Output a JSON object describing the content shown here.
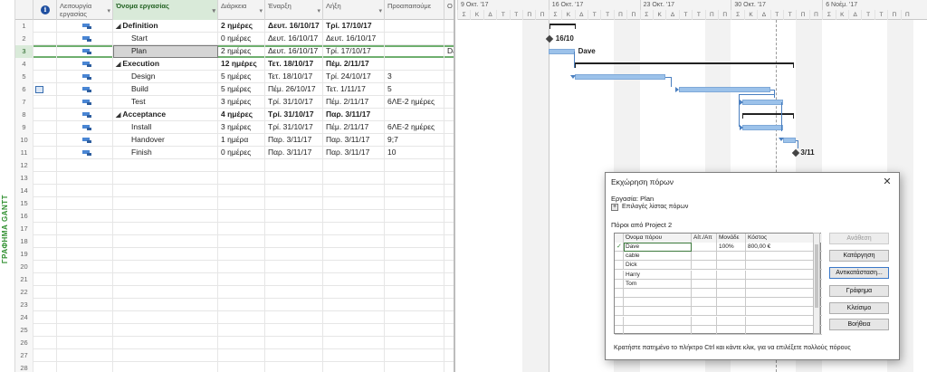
{
  "side_label": "ΓΡΑΦΗΜΑ GANTT",
  "table": {
    "headers": {
      "info": "i",
      "mode": "Λειτουργία εργασίας",
      "name": "Όνομα εργασίας",
      "duration": "Διάρκεια",
      "start": "Έναρξη",
      "finish": "Λήξη",
      "predecessors": "Προαπαιτούμε",
      "resources": "Ο"
    },
    "rows": [
      {
        "num": "1",
        "name": "Definition",
        "duration": "2 ημέρες",
        "start": "Δευτ. 16/10/17",
        "finish": "Τρί. 17/10/17",
        "pred": "",
        "res": ""
      },
      {
        "num": "2",
        "name": "Start",
        "duration": "0 ημέρες",
        "start": "Δευτ. 16/10/17",
        "finish": "Δευτ. 16/10/17",
        "pred": "",
        "res": ""
      },
      {
        "num": "3",
        "name": "Plan",
        "duration": "2 ημέρες",
        "start": "Δευτ. 16/10/17",
        "finish": "Τρί. 17/10/17",
        "pred": "",
        "res": "Da"
      },
      {
        "num": "4",
        "name": "Execution",
        "duration": "12 ημέρες",
        "start": "Τετ. 18/10/17",
        "finish": "Πέμ. 2/11/17",
        "pred": "",
        "res": ""
      },
      {
        "num": "5",
        "name": "Design",
        "duration": "5 ημέρες",
        "start": "Τετ. 18/10/17",
        "finish": "Τρί. 24/10/17",
        "pred": "3",
        "res": ""
      },
      {
        "num": "6",
        "name": "Build",
        "duration": "5 ημέρες",
        "start": "Πέμ. 26/10/17",
        "finish": "Τετ. 1/11/17",
        "pred": "5",
        "res": ""
      },
      {
        "num": "7",
        "name": "Test",
        "duration": "3 ημέρες",
        "start": "Τρί. 31/10/17",
        "finish": "Πέμ. 2/11/17",
        "pred": "6ΛΕ-2 ημέρες",
        "res": ""
      },
      {
        "num": "8",
        "name": "Acceptance",
        "duration": "4 ημέρες",
        "start": "Τρί. 31/10/17",
        "finish": "Παρ. 3/11/17",
        "pred": "",
        "res": ""
      },
      {
        "num": "9",
        "name": "Install",
        "duration": "3 ημέρες",
        "start": "Τρί. 31/10/17",
        "finish": "Πέμ. 2/11/17",
        "pred": "6ΛΕ-2 ημέρες",
        "res": ""
      },
      {
        "num": "10",
        "name": "Handover",
        "duration": "1 ημέρα",
        "start": "Παρ. 3/11/17",
        "finish": "Παρ. 3/11/17",
        "pred": "9;7",
        "res": ""
      },
      {
        "num": "11",
        "name": "Finish",
        "duration": "0 ημέρες",
        "start": "Παρ. 3/11/17",
        "finish": "Παρ. 3/11/17",
        "pred": "10",
        "res": ""
      }
    ],
    "empty_row_numbers": [
      "12",
      "13",
      "14",
      "15",
      "16",
      "17",
      "18",
      "19",
      "20",
      "21",
      "22",
      "23",
      "24",
      "25",
      "26",
      "27",
      "28"
    ]
  },
  "timeline": {
    "weeks": [
      "9 Οκτ. '17",
      "16 Οκτ. '17",
      "23 Οκτ. '17",
      "30 Οκτ. '17",
      "6 Νοέμ. '17"
    ],
    "days": [
      "Σ",
      "Κ",
      "Δ",
      "Τ",
      "Τ",
      "Π",
      "Π"
    ],
    "labels": {
      "start_milestone": "16/10",
      "plan_resource": "Dave",
      "finish_milestone": "3/11"
    }
  },
  "dialog": {
    "title": "Εκχώρηση πόρων",
    "close": "✕",
    "task_label": "Εργασία: Plan",
    "options_toggle": "+",
    "options_label": "Επιλογές λίστας πόρων",
    "resources_from": "Πόροι από Project 2",
    "columns": {
      "name": "Όνομα πόρου",
      "request": "Αίτ./Απ",
      "units": "Μονάδε",
      "cost": "Κόστος"
    },
    "resources": [
      {
        "check": "✓",
        "name": "Dave",
        "request": "",
        "units": "100%",
        "cost": "800,00 €"
      },
      {
        "check": "",
        "name": "cable",
        "request": "",
        "units": "",
        "cost": ""
      },
      {
        "check": "",
        "name": "Dick",
        "request": "",
        "units": "",
        "cost": ""
      },
      {
        "check": "",
        "name": "Harry",
        "request": "",
        "units": "",
        "cost": ""
      },
      {
        "check": "",
        "name": "Tom",
        "request": "",
        "units": "",
        "cost": ""
      }
    ],
    "buttons": {
      "assign": "Ανάθεση",
      "remove": "Κατάργηση",
      "replace": "Αντικατάσταση...",
      "graphs": "Γράφημα",
      "close": "Κλείσιμο",
      "help": "Βοήθεια"
    },
    "footer": "Κρατήστε πατημένο το πλήκτρο Ctrl και κάντε κλικ, για να επιλέξετε πολλούς πόρους"
  }
}
